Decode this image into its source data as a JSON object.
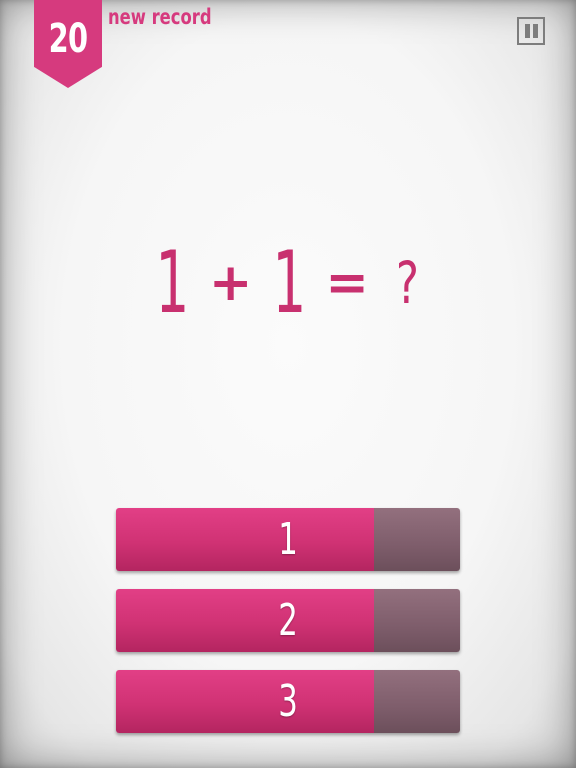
{
  "header": {
    "score": "20",
    "record_label": "new record"
  },
  "question": {
    "operand_a": "1",
    "operator": "+",
    "operand_b": "1",
    "equals": "=",
    "unknown": "?"
  },
  "answers": [
    {
      "label": "1"
    },
    {
      "label": "2"
    },
    {
      "label": "3"
    }
  ],
  "icons": {
    "pause": "pause-icon"
  },
  "colors": {
    "accent": "#d63a7e",
    "equation_text": "#c8306f",
    "answer_main": "#d03274",
    "answer_side": "#7e5d6b",
    "pause_icon": "#7d7d7d",
    "background": "#f4f4f4"
  }
}
